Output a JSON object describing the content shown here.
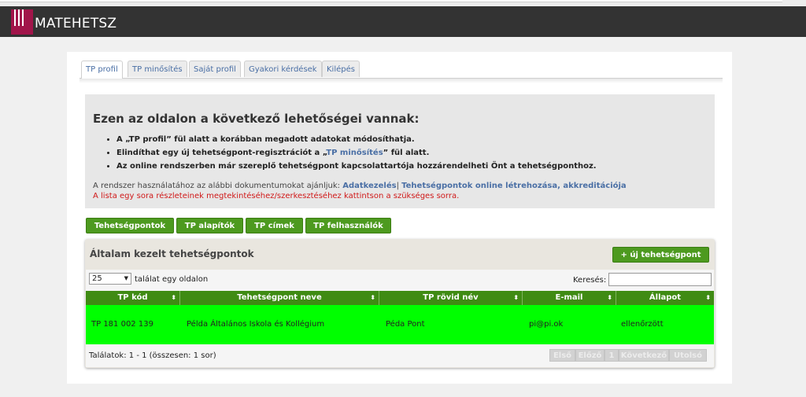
{
  "app": {
    "logo_text": "MATEHETSZ"
  },
  "tabs": [
    {
      "label": "TP profil",
      "active": true
    },
    {
      "label": "TP minősítés"
    },
    {
      "label": "Saját profil"
    },
    {
      "label": "Gyakori kérdések"
    },
    {
      "label": "Kilépés"
    }
  ],
  "info": {
    "heading": "Ezen az oldalon a következő lehetőségei vannak:",
    "bullet1": "A „TP profil” fül alatt a korábban megadott adatokat módosíthatja.",
    "bullet2_pre": "Elindíthat egy új tehetségpont-regisztrációt a „",
    "bullet2_link": "TP minősítés",
    "bullet2_post": "” fül alatt.",
    "bullet3": "Az online rendszerben már szereplő tehetségpont kapcsolattartója hozzárendelheti Önt a tehetségponthoz.",
    "doc_prefix": "A rendszer használatához az alábbi dokumentumokat ajánljuk:",
    "doc_link1": "Adatkezelés",
    "doc_sep": "|",
    "doc_link2": "Tehetségpontok online létrehozása, akkreditációja",
    "red_note": "A lista egy sora részleteinek megtekintéséhez/szerkesztéséhez kattintson a szükséges sorra."
  },
  "buttons": {
    "tehetsegpontok": "Tehetségpontok",
    "alapitok": "TP alapítók",
    "cimek": "TP címek",
    "felhasznalok": "TP felhasználók"
  },
  "panel": {
    "title": "Általam kezelt tehetségpontok",
    "new_button": "+ új tehetségpont"
  },
  "grid": {
    "page_length": "25",
    "page_length_label": "találat egy oldalon",
    "search_label": "Keresés:",
    "search_value": "",
    "columns": [
      "TP kód",
      "Tehetségpont neve",
      "TP rövid név",
      "E-mail",
      "Állapot"
    ],
    "rows": [
      [
        "TP 181 002 139",
        "Példa Általános Iskola és Kollégium",
        "Péda Pont",
        "pi@pi.ok",
        "ellenőrzött"
      ]
    ],
    "info_text": "Találatok: 1 - 1 (összesen: 1 sor)",
    "pagination": {
      "first": "Első",
      "prev": "Előző",
      "page": "1",
      "next": "Következő",
      "last": "Utolsó"
    }
  },
  "colors": {
    "header_bg": "#333333",
    "logo_accent": "#a1154a",
    "button_green": "#4d9a1f",
    "table_head": "#3f8b13",
    "row_highlight": "#00ff00",
    "link_blue": "#4a6fa5",
    "note_red": "#d01818"
  }
}
